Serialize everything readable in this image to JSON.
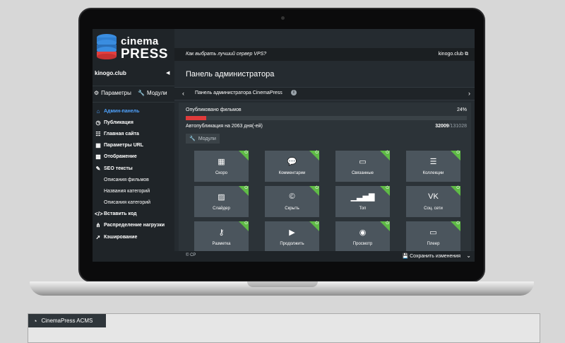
{
  "logo": {
    "line1": "cinema",
    "line2": "PRESS"
  },
  "sidebar": {
    "site_name": "kinogo.club",
    "tabs": [
      {
        "icon": "gears-icon",
        "label": "Параметры"
      },
      {
        "icon": "wrench-icon",
        "label": "Модули"
      }
    ],
    "nav": [
      {
        "icon": "home-icon",
        "label": "Админ-панель",
        "active": true
      },
      {
        "icon": "clock-icon",
        "label": "Публикация"
      },
      {
        "icon": "list-icon",
        "label": "Главная сайта"
      },
      {
        "icon": "table-icon",
        "label": "Параметры URL"
      },
      {
        "icon": "grid-icon",
        "label": "Отображение"
      },
      {
        "icon": "pencil-icon",
        "label": "SEO тексты"
      }
    ],
    "sub": [
      "Описания фильмов",
      "Названия категорий",
      "Описания категорий"
    ],
    "nav2": [
      {
        "icon": "code-icon",
        "label": "Вставить код"
      },
      {
        "icon": "share-icon",
        "label": "Распределение нагрузки"
      },
      {
        "icon": "rocket-icon",
        "label": "Кэширование"
      }
    ]
  },
  "topbar": {
    "link": "Как выбрать лучший сервер VPS?",
    "site": "kinogo.club"
  },
  "page_title": "Панель администратора",
  "breadcrumb": {
    "text": "Панель администратора CinemaPress",
    "info": "i"
  },
  "publication": {
    "label": "Опубликовано фильмов",
    "percent_text": "24%",
    "progress": 0.24
  },
  "autopublish": {
    "label": "Автопубликация на 2063 дня(-ей)",
    "count": "32009",
    "total": "/131028"
  },
  "modules_button": "Модули",
  "tiles": [
    {
      "icon": "calendar-icon",
      "glyph": "▦",
      "label": "Скоро"
    },
    {
      "icon": "comments-icon",
      "glyph": "💬",
      "label": "Комментарии"
    },
    {
      "icon": "related-icon",
      "glyph": "▭",
      "label": "Связанные"
    },
    {
      "icon": "collections-icon",
      "glyph": "☰",
      "label": "Коллекции"
    },
    {
      "icon": "image-icon",
      "glyph": "▨",
      "label": "Слайдер"
    },
    {
      "icon": "copyright-icon",
      "glyph": "©",
      "label": "Скрыть"
    },
    {
      "icon": "signal-icon",
      "glyph": "▁▃▅▇",
      "label": "Топ"
    },
    {
      "icon": "vk-icon",
      "glyph": "VK",
      "label": "Соц. сети"
    },
    {
      "icon": "key-icon",
      "glyph": "⚷",
      "label": "Разметка"
    },
    {
      "icon": "play-icon",
      "glyph": "▶",
      "label": "Продолжить"
    },
    {
      "icon": "eye-icon",
      "glyph": "◉",
      "label": "Просмотр"
    },
    {
      "icon": "monitor-icon",
      "glyph": "▭",
      "label": "Плеер"
    }
  ],
  "footer": {
    "copyright": "© CP",
    "save": "Сохранить изменения"
  },
  "bottom_tab": {
    "label": "CinemaPress ACMS"
  },
  "colors": {
    "accent": "#4fa3ff",
    "progress": "#e03b3b",
    "tile_on": "#5fbb46"
  }
}
